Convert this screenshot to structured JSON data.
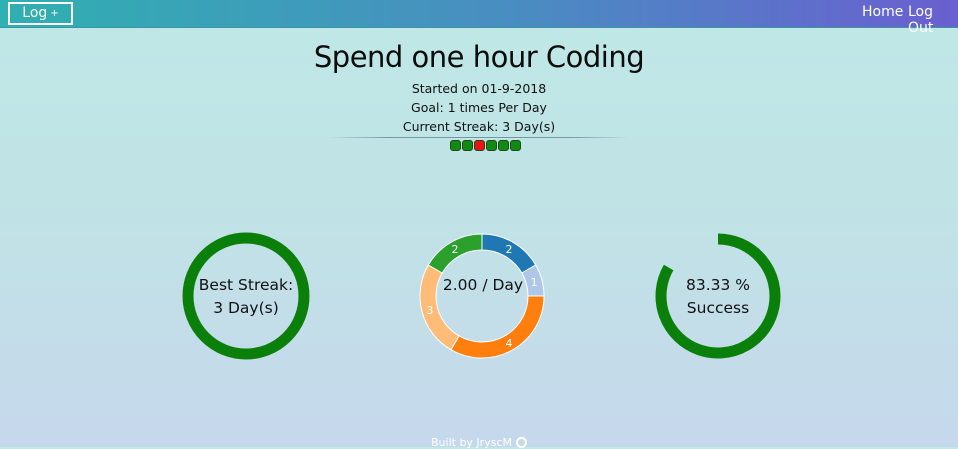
{
  "nav": {
    "log_button": "Log",
    "log_button_icon": "plus-icon",
    "home": "Home",
    "logout": "Log Out"
  },
  "habit": {
    "title": "Spend one hour Coding",
    "started": "Started on 01-9-2018",
    "goal": "Goal: 1 times Per Day",
    "current_streak": "Current Streak: 3 Day(s)",
    "history": [
      {
        "status": "done",
        "color": "#118a11"
      },
      {
        "status": "done",
        "color": "#118a11"
      },
      {
        "status": "missed",
        "color": "#ee1111"
      },
      {
        "status": "done",
        "color": "#118a11"
      },
      {
        "status": "done",
        "color": "#118a11"
      },
      {
        "status": "done",
        "color": "#118a11"
      }
    ]
  },
  "best_streak": {
    "line1": "Best Streak:",
    "line2": "3 Day(s)",
    "fraction": 1.0,
    "color": "#0a7f0a"
  },
  "average": {
    "text": "2.00 / Day"
  },
  "success": {
    "line1": "83.33 %",
    "line2": "Success",
    "fraction": 0.8333,
    "color": "#0a7f0a"
  },
  "chart_data": {
    "type": "pie",
    "donut": true,
    "center_label": "2.00 / Day",
    "values": [
      2,
      1,
      4,
      3,
      2
    ],
    "labels": [
      "2",
      "1",
      "4",
      "3",
      "2"
    ],
    "colors": [
      "#1f77b4",
      "#aec7e8",
      "#ff7f0e",
      "#ffbb78",
      "#2ca02c"
    ]
  },
  "footer": {
    "text": "Built by JryscM",
    "icon": "github-icon"
  }
}
